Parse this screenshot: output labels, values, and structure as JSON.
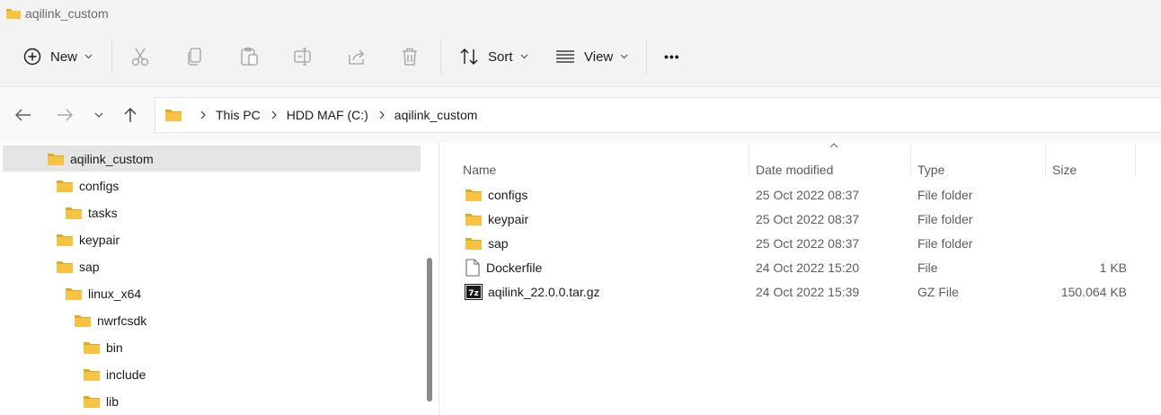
{
  "window": {
    "title": "aqilink_custom"
  },
  "toolbar": {
    "new_label": "New",
    "sort_label": "Sort",
    "view_label": "View",
    "more_label": "•••"
  },
  "address": {
    "crumbs": [
      "This PC",
      "HDD MAF (C:)",
      "aqilink_custom"
    ]
  },
  "tree": {
    "items": [
      {
        "label": "aqilink_custom",
        "selected": true
      },
      {
        "label": "configs"
      },
      {
        "label": "tasks"
      },
      {
        "label": "keypair"
      },
      {
        "label": "sap"
      },
      {
        "label": "linux_x64"
      },
      {
        "label": "nwrfcsdk"
      },
      {
        "label": "bin"
      },
      {
        "label": "include"
      },
      {
        "label": "lib"
      }
    ]
  },
  "list": {
    "columns": {
      "name": "Name",
      "date": "Date modified",
      "type": "Type",
      "size": "Size"
    },
    "rows": [
      {
        "name": "configs",
        "date": "25 Oct 2022 08:37",
        "type": "File folder",
        "size": "",
        "icon": "folder-icon"
      },
      {
        "name": "keypair",
        "date": "25 Oct 2022 08:37",
        "type": "File folder",
        "size": "",
        "icon": "folder-icon"
      },
      {
        "name": "sap",
        "date": "25 Oct 2022 08:37",
        "type": "File folder",
        "size": "",
        "icon": "folder-icon"
      },
      {
        "name": "Dockerfile",
        "date": "24 Oct 2022 15:20",
        "type": "File",
        "size": "1 KB",
        "icon": "file-icon"
      },
      {
        "name": "aqilink_22.0.0.tar.gz",
        "date": "24 Oct 2022 15:39",
        "type": "GZ File",
        "size": "150.064 KB",
        "icon": "7z-archive-icon",
        "icon_text": "7z"
      }
    ]
  },
  "colors": {
    "folder": "#f6c342",
    "folder_dark": "#e0a820",
    "selection": "#e5e5e5"
  }
}
